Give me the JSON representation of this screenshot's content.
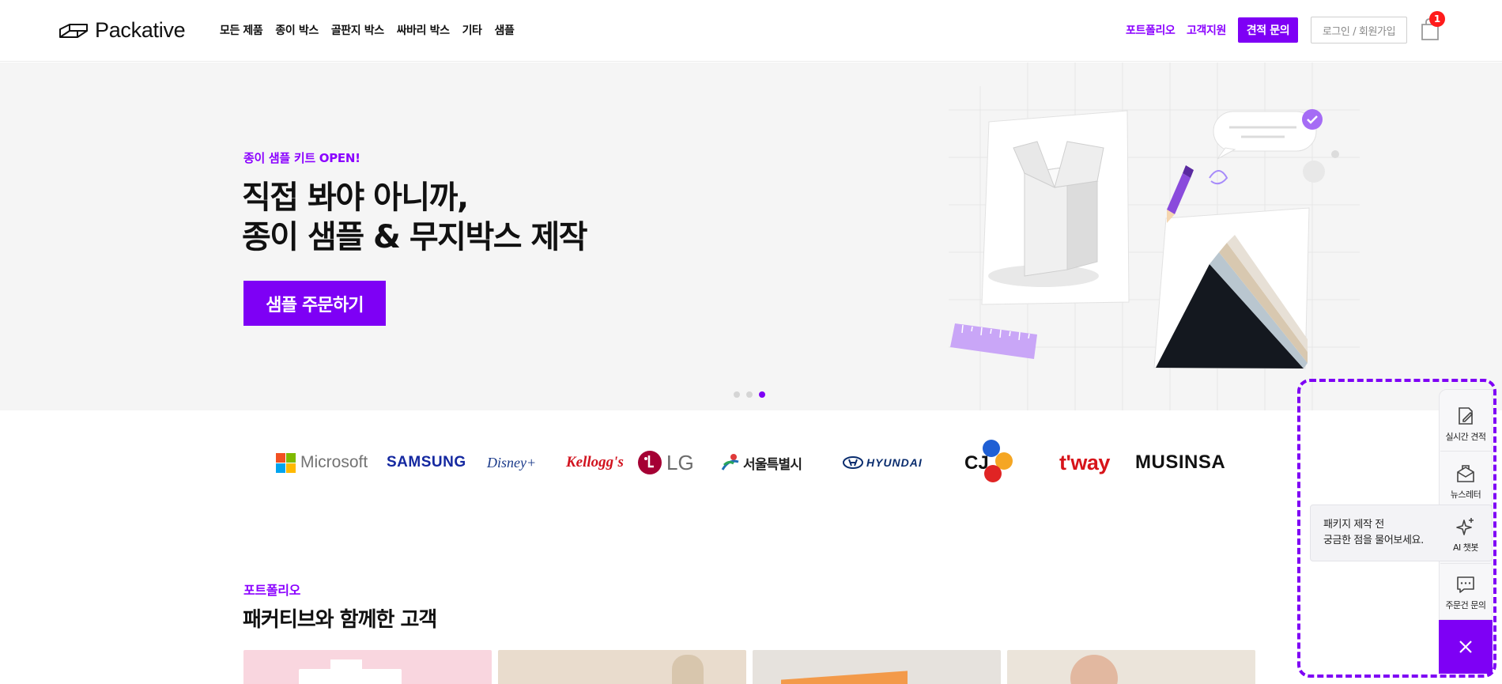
{
  "header": {
    "brand": "Packative",
    "nav": [
      "모든 제품",
      "종이 박스",
      "골판지 박스",
      "싸바리 박스",
      "기타",
      "샘플"
    ],
    "portfolio_link": "포트폴리오",
    "support_link": "고객지원",
    "quote_button": "견적 문의",
    "login_button": "로그인 / 회원가입",
    "cart_count": "1"
  },
  "hero": {
    "eyebrow": "종이 샘플 키트 OPEN!",
    "title_line1": "직접 봐야 아니까,",
    "title_line2": "종이 샘플 & 무지박스 제작",
    "cta": "샘플 주문하기",
    "slides_total": 3,
    "active_slide": 3
  },
  "clients": [
    "Microsoft",
    "SAMSUNG",
    "Disney+",
    "Kellogg's",
    "LG",
    "서울특별시",
    "HYUNDAI",
    "CJ",
    "t'way",
    "MUSINSA"
  ],
  "portfolio": {
    "eyebrow": "포트폴리오",
    "title": "패커티브와 함께한 고객"
  },
  "side_panel": {
    "items": [
      "실시간 견적",
      "뉴스레터",
      "AI 챗봇",
      "주문건 문의"
    ],
    "ai_prompt_line1": "패키지 제작 전",
    "ai_prompt_line2": "궁금한 점을 물어보세요."
  },
  "colors": {
    "brand_purple": "#7e00f5",
    "badge_red": "#ff1b1b",
    "hero_bg": "#f5f5f5"
  }
}
